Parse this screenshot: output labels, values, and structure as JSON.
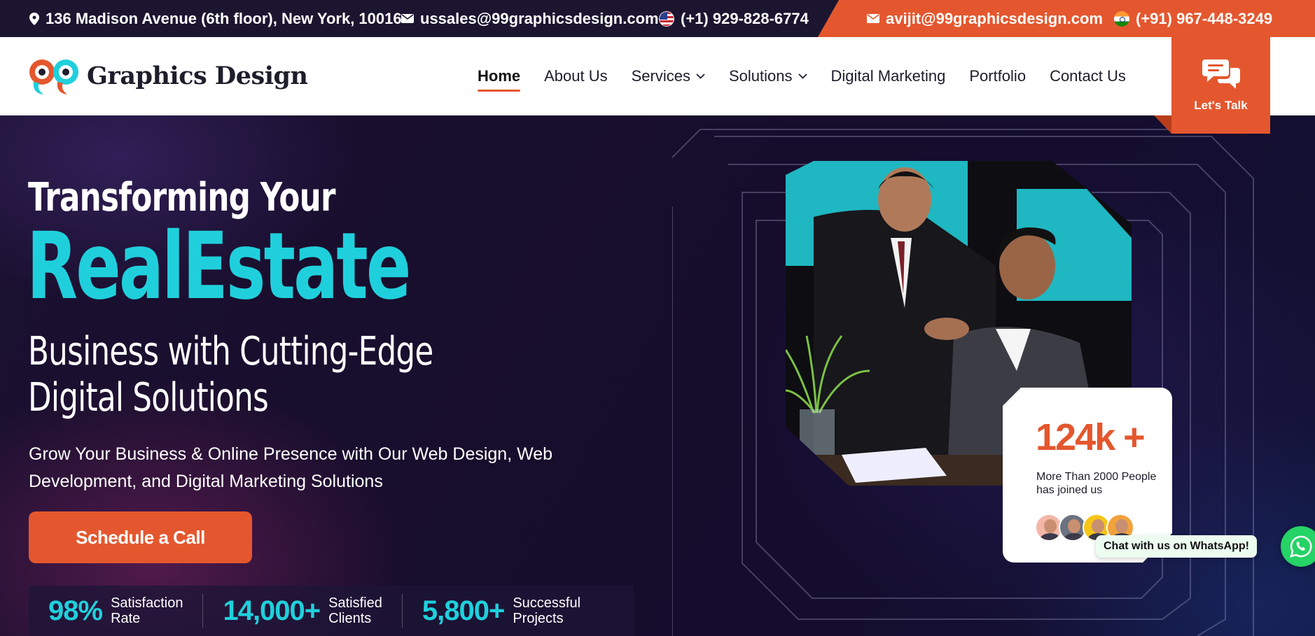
{
  "topbar": {
    "address": "136 Madison Avenue (6th floor), New York, 10016",
    "email_us": "ussales@99graphicsdesign.com",
    "phone_us": "(+1) 929-828-6774",
    "email_in": "avijit@99graphicsdesign.com",
    "phone_in": "(+91) 967-448-3249"
  },
  "brand": {
    "name": "Graphics Design"
  },
  "nav": {
    "items": [
      {
        "label": "Home",
        "active": true,
        "has_dropdown": false
      },
      {
        "label": "About Us",
        "active": false,
        "has_dropdown": false
      },
      {
        "label": "Services",
        "active": false,
        "has_dropdown": true
      },
      {
        "label": "Solutions",
        "active": false,
        "has_dropdown": true
      },
      {
        "label": "Digital Marketing",
        "active": false,
        "has_dropdown": false
      },
      {
        "label": "Portfolio",
        "active": false,
        "has_dropdown": false
      },
      {
        "label": "Contact Us",
        "active": false,
        "has_dropdown": false
      }
    ],
    "cta_label": "Let's Talk"
  },
  "hero": {
    "line1": "Transforming Your",
    "highlight": "RealEstate",
    "line3a": "Business with Cutting-Edge",
    "line3b": "Digital Solutions",
    "subtitle": "Grow Your Business & Online Presence with Our Web Design, Web Development, and Digital Marketing Solutions",
    "cta": "Schedule a Call",
    "stats": [
      {
        "value": "98%",
        "label": "Satisfaction\nRate"
      },
      {
        "value": "14,000+",
        "label": "Satisfied\nClients"
      },
      {
        "value": "5,800+",
        "label": "Successful\nProjects"
      }
    ]
  },
  "card": {
    "number": "124k +",
    "text": "More Than 2000 People has joined us"
  },
  "whatsapp": {
    "label": "Chat with us on WhatsApp!"
  },
  "colors": {
    "accent": "#e4572e",
    "highlight": "#1fd0dc",
    "dark": "#1c1530",
    "whatsapp": "#25d366"
  }
}
